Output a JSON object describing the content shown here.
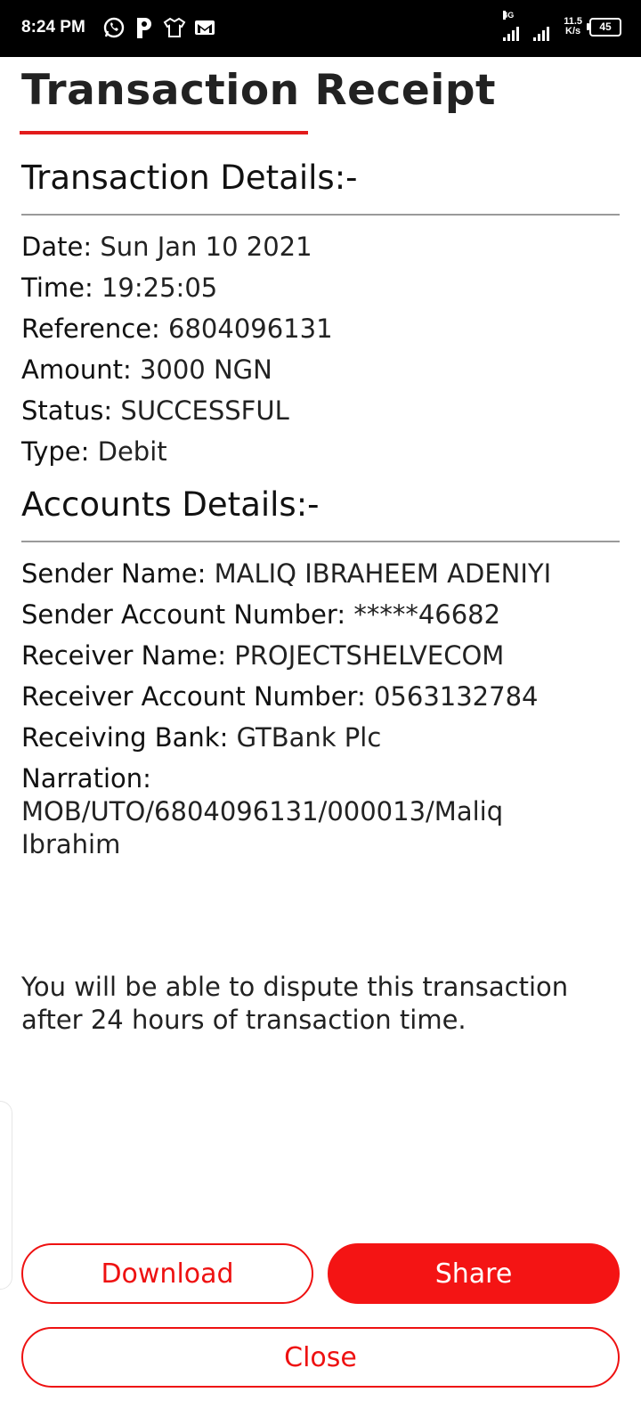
{
  "status_bar": {
    "time": "8:24 PM",
    "network": "4G",
    "speed_value": "11.5",
    "speed_unit": "K/s",
    "battery": "45",
    "icons": [
      "whatsapp-icon",
      "p-app-icon",
      "shirt-app-icon",
      "gmail-icon"
    ]
  },
  "title": "Transaction Receipt",
  "accent_color": "#E21B1B",
  "transaction_details": {
    "heading": "Transaction Details:-",
    "rows": [
      {
        "label": "Date:",
        "value": "Sun Jan 10 2021"
      },
      {
        "label": "Time:",
        "value": "19:25:05"
      },
      {
        "label": "Reference:",
        "value": "6804096131"
      },
      {
        "label": "Amount:",
        "value": "3000 NGN"
      },
      {
        "label": "Status:",
        "value": "SUCCESSFUL"
      },
      {
        "label": "Type:",
        "value": "Debit"
      }
    ]
  },
  "account_details": {
    "heading": "Accounts Details:-",
    "rows": [
      {
        "label": "Sender Name:",
        "value": "MALIQ IBRAHEEM ADENIYI"
      },
      {
        "label": "Sender Account Number:",
        "value": "*****46682"
      },
      {
        "label": "Receiver Name:",
        "value": "PROJECTSHELVECOM"
      },
      {
        "label": "Receiver Account Number:",
        "value": "0563132784"
      },
      {
        "label": "Receiving Bank:",
        "value": "GTBank Plc"
      }
    ],
    "narration": {
      "label": "Narration:",
      "value": "MOB/UTO/6804096131/000013/Maliq Ibrahim"
    }
  },
  "dispute_note": "You will be able to dispute this transaction after 24 hours of transaction time.",
  "buttons": {
    "download": "Download",
    "share": "Share",
    "close": "Close"
  }
}
